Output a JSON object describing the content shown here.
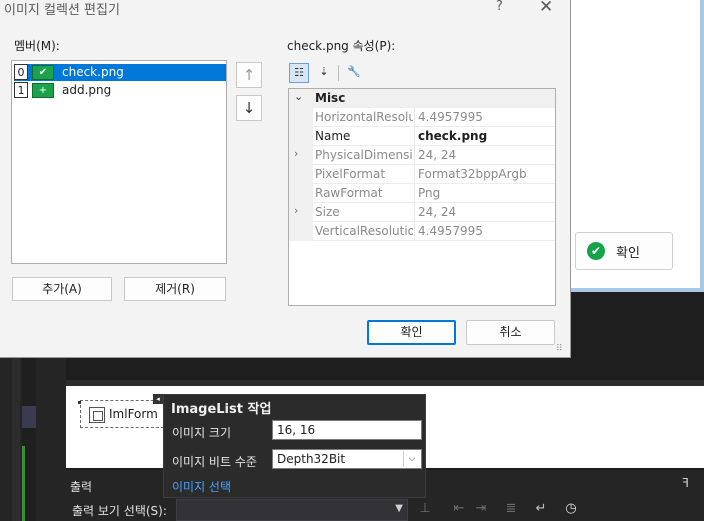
{
  "dialog": {
    "title": "이미지 컬렉션 편집기",
    "help": "?",
    "close": "✕",
    "members_label": "멤버(M):",
    "members": [
      {
        "index": "0",
        "name": "check.png",
        "thumb": "✔"
      },
      {
        "index": "1",
        "name": "add.png",
        "thumb": "+"
      }
    ],
    "move_up": "↑",
    "move_down": "↓",
    "add_label": "추가(A)",
    "remove_label": "제거(R)",
    "props_label": "check.png 속성(P):",
    "category": "Misc",
    "properties": [
      {
        "name": "HorizontalResolution",
        "value": "4.4957995",
        "expander": ""
      },
      {
        "name": "Name",
        "value": "check.png",
        "expander": ""
      },
      {
        "name": "PhysicalDimension",
        "value": "24, 24",
        "expander": "›"
      },
      {
        "name": "PixelFormat",
        "value": "Format32bppArgb",
        "expander": ""
      },
      {
        "name": "RawFormat",
        "value": "Png",
        "expander": ""
      },
      {
        "name": "Size",
        "value": "24, 24",
        "expander": "›"
      },
      {
        "name": "VerticalResolution",
        "value": "4.4957995",
        "expander": ""
      }
    ],
    "ok_label": "확인",
    "cancel_label": "취소"
  },
  "background_form": {
    "ok_label": "확인"
  },
  "designer": {
    "component_label": "ImlForm"
  },
  "tasks_panel": {
    "title": "ImageList 작업",
    "image_size_label": "이미지 크기",
    "image_size_value": "16, 16",
    "bit_depth_label": "이미지 비트 수준",
    "bit_depth_value": "Depth32Bit",
    "choose_images_link": "이미지 선택"
  },
  "output_panel": {
    "title": "출력",
    "source_label": "출력 보기 선택(S):",
    "source_value": ""
  },
  "icons": {
    "categorized": "categorized-icon",
    "alphabetical": "alphabetical-sort-icon",
    "property_pages": "wrench-icon",
    "check": "check-circle-icon"
  },
  "colors": {
    "accent": "#0078d7",
    "selection": "#0078d7",
    "link": "#4aa3ff",
    "green": "#16a34a"
  }
}
